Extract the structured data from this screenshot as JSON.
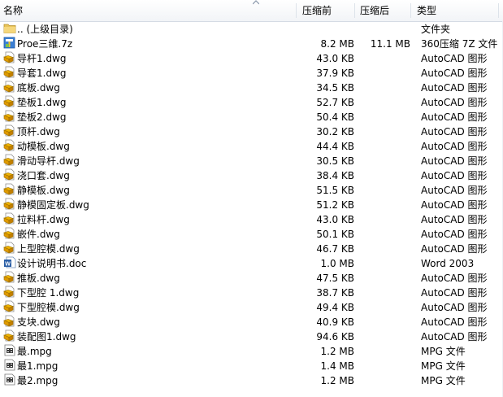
{
  "header": {
    "name": "名称",
    "compressed": "压缩前",
    "uncompressed": "压缩后",
    "type": "类型"
  },
  "rows": [
    {
      "icon": "folder-up-icon",
      "name": ".. (上级目录)",
      "compressed": "",
      "uncompressed": "",
      "type": "文件夹"
    },
    {
      "icon": "archive-7z-icon",
      "name": "Proe三维.7z",
      "compressed": "8.2 MB",
      "uncompressed": "11.1 MB",
      "type": "360压缩 7Z 文件"
    },
    {
      "icon": "dwg-file-icon",
      "name": "导杆1.dwg",
      "compressed": "43.0 KB",
      "uncompressed": "",
      "type": "AutoCAD 图形"
    },
    {
      "icon": "dwg-file-icon",
      "name": "导套1.dwg",
      "compressed": "37.9 KB",
      "uncompressed": "",
      "type": "AutoCAD 图形"
    },
    {
      "icon": "dwg-file-icon",
      "name": "底板.dwg",
      "compressed": "34.5 KB",
      "uncompressed": "",
      "type": "AutoCAD 图形"
    },
    {
      "icon": "dwg-file-icon",
      "name": "垫板1.dwg",
      "compressed": "52.7 KB",
      "uncompressed": "",
      "type": "AutoCAD 图形"
    },
    {
      "icon": "dwg-file-icon",
      "name": "垫板2.dwg",
      "compressed": "50.4 KB",
      "uncompressed": "",
      "type": "AutoCAD 图形"
    },
    {
      "icon": "dwg-file-icon",
      "name": "顶杆.dwg",
      "compressed": "30.2 KB",
      "uncompressed": "",
      "type": "AutoCAD 图形"
    },
    {
      "icon": "dwg-file-icon",
      "name": "动模板.dwg",
      "compressed": "44.4 KB",
      "uncompressed": "",
      "type": "AutoCAD 图形"
    },
    {
      "icon": "dwg-file-icon",
      "name": "滑动导杆.dwg",
      "compressed": "30.5 KB",
      "uncompressed": "",
      "type": "AutoCAD 图形"
    },
    {
      "icon": "dwg-file-icon",
      "name": "浇口套.dwg",
      "compressed": "38.4 KB",
      "uncompressed": "",
      "type": "AutoCAD 图形"
    },
    {
      "icon": "dwg-file-icon",
      "name": "静模板.dwg",
      "compressed": "51.5 KB",
      "uncompressed": "",
      "type": "AutoCAD 图形"
    },
    {
      "icon": "dwg-file-icon",
      "name": "静模固定板.dwg",
      "compressed": "51.2 KB",
      "uncompressed": "",
      "type": "AutoCAD 图形"
    },
    {
      "icon": "dwg-file-icon",
      "name": "拉料杆.dwg",
      "compressed": "43.0 KB",
      "uncompressed": "",
      "type": "AutoCAD 图形"
    },
    {
      "icon": "dwg-file-icon",
      "name": "嵌件.dwg",
      "compressed": "50.1 KB",
      "uncompressed": "",
      "type": "AutoCAD 图形"
    },
    {
      "icon": "dwg-file-icon",
      "name": "上型腔模.dwg",
      "compressed": "46.7 KB",
      "uncompressed": "",
      "type": "AutoCAD 图形"
    },
    {
      "icon": "word-doc-icon",
      "name": "设计说明书.doc",
      "compressed": "1.0 MB",
      "uncompressed": "",
      "type": "Word 2003"
    },
    {
      "icon": "dwg-file-icon",
      "name": "推板.dwg",
      "compressed": "47.5 KB",
      "uncompressed": "",
      "type": "AutoCAD 图形"
    },
    {
      "icon": "dwg-file-icon",
      "name": "下型腔 1.dwg",
      "compressed": "38.7 KB",
      "uncompressed": "",
      "type": "AutoCAD 图形"
    },
    {
      "icon": "dwg-file-icon",
      "name": "下型腔模.dwg",
      "compressed": "49.4 KB",
      "uncompressed": "",
      "type": "AutoCAD 图形"
    },
    {
      "icon": "dwg-file-icon",
      "name": "支块.dwg",
      "compressed": "40.9 KB",
      "uncompressed": "",
      "type": "AutoCAD 图形"
    },
    {
      "icon": "dwg-file-icon",
      "name": "装配图1.dwg",
      "compressed": "94.6 KB",
      "uncompressed": "",
      "type": "AutoCAD 图形"
    },
    {
      "icon": "mpg-file-icon",
      "name": "最.mpg",
      "compressed": "1.2 MB",
      "uncompressed": "",
      "type": "MPG 文件"
    },
    {
      "icon": "mpg-file-icon",
      "name": "最1.mpg",
      "compressed": "1.4 MB",
      "uncompressed": "",
      "type": "MPG 文件"
    },
    {
      "icon": "mpg-file-icon",
      "name": "最2.mpg",
      "compressed": "1.2 MB",
      "uncompressed": "",
      "type": "MPG 文件"
    }
  ]
}
